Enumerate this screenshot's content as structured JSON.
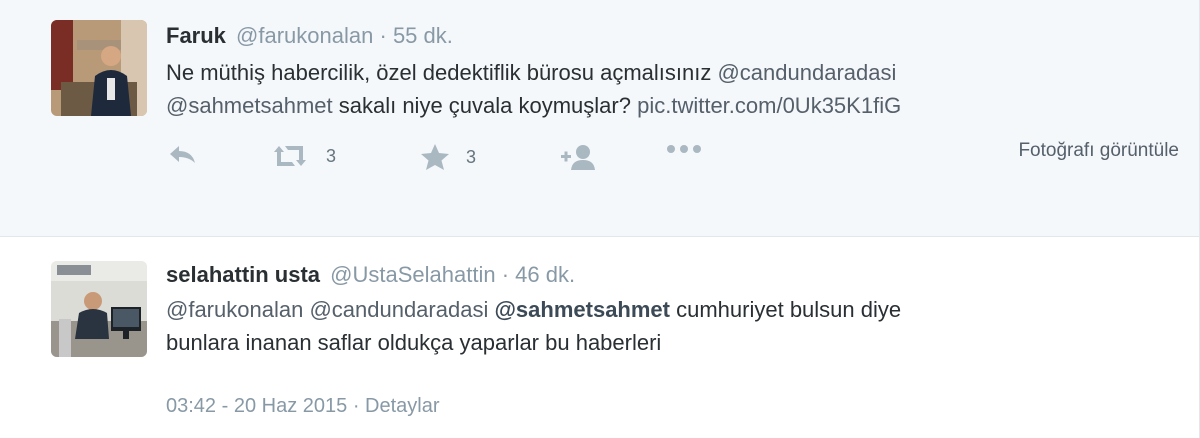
{
  "tweets": [
    {
      "fullname": "Faruk",
      "username": "@farukonalan",
      "separator": "·",
      "time": "55 dk.",
      "text_parts": [
        {
          "type": "text",
          "value": "Ne müthiş habercilik, özel dedektiflik bürosu açmalısınız "
        },
        {
          "type": "mention",
          "value": "@candundaradasi"
        },
        {
          "type": "break"
        },
        {
          "type": "mention",
          "value": "@sahmetsahmet"
        },
        {
          "type": "text",
          "value": " sakalı niye çuvala koymuşlar? "
        },
        {
          "type": "link",
          "value": "pic.twitter.com/0Uk35K1fiG"
        }
      ],
      "retweet_count": "3",
      "favorite_count": "3",
      "photo_link": "Fotoğrafı görüntüle",
      "icons": {
        "reply": "reply-icon",
        "retweet": "retweet-icon",
        "favorite": "star-icon",
        "follow": "follow-user-icon",
        "more": "more-dots-icon"
      }
    },
    {
      "fullname": "selahattin usta",
      "username": "@UstaSelahattin",
      "separator": "·",
      "time": "46 dk.",
      "text_line1_a": "@farukonalan",
      "text_line1_b": "@candundaradasi",
      "text_line1_c": "@sahmetsahmet",
      "text_line1_d": " cumhuriyet bulsun diye",
      "text_line2": "bunlara inanan saflar oldukça yaparlar bu haberleri",
      "footer_datetime": "03:42 - 20 Haz 2015",
      "footer_sep": "·",
      "footer_details": "Detaylar"
    }
  ],
  "colors": {
    "background_selected": "#f5f8fa",
    "text": "#292f33",
    "muted": "#8899a6",
    "icon": "#aab8c2"
  }
}
